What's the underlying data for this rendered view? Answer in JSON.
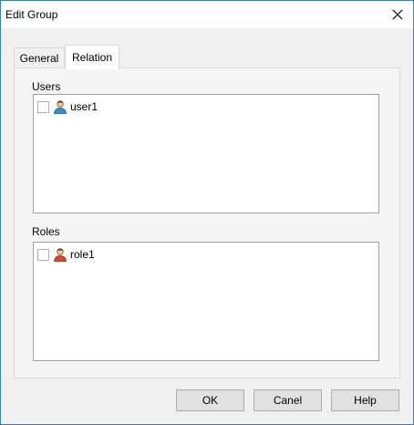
{
  "window": {
    "title": "Edit Group"
  },
  "tabs": [
    {
      "label": "General",
      "active": false
    },
    {
      "label": "Relation",
      "active": true
    }
  ],
  "relation": {
    "users": {
      "label": "Users",
      "items": [
        {
          "label": "user1",
          "checked": false,
          "icon": "user-icon"
        }
      ]
    },
    "roles": {
      "label": "Roles",
      "items": [
        {
          "label": "role1",
          "checked": false,
          "icon": "role-icon"
        }
      ]
    }
  },
  "buttons": {
    "ok": "OK",
    "cancel": "Canel",
    "help": "Help"
  },
  "colors": {
    "user_icon": "#2f8fd6",
    "role_icon": "#e0442a"
  }
}
